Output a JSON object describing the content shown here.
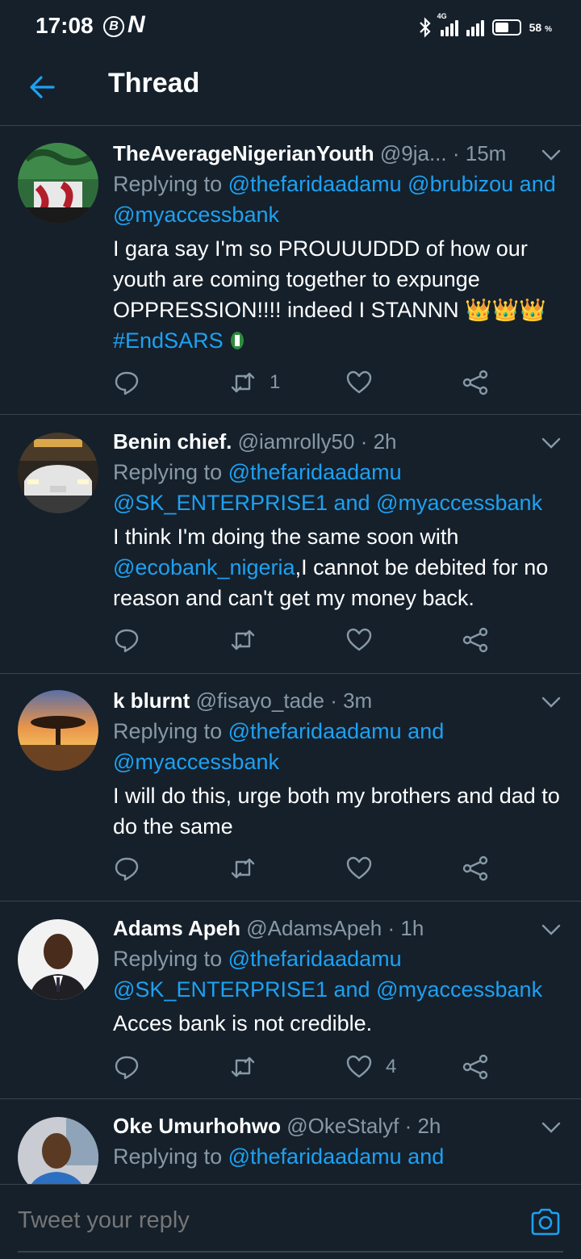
{
  "status_bar": {
    "time": "17:08",
    "network_tag": "4G",
    "battery_percent": "58",
    "battery_unit": "%",
    "battery_level": 0.58
  },
  "header": {
    "title": "Thread"
  },
  "tweets": [
    {
      "name": "TheAverageNigerianYouth",
      "handle": "@9ja...",
      "time": "· 15m",
      "replying_prefix": "Replying to",
      "mentions": [
        "@thefaridaadamu",
        "@brubizou",
        "and",
        "@myaccessbank"
      ],
      "text": "I gara say I'm so PROUUUDDD of how our youth are coming together to expunge OPPRESSION!!!! indeed I STANNN",
      "emoji": "👑👑👑",
      "hashtag": "#EndSARS",
      "retweets": "1",
      "likes": ""
    },
    {
      "name": "Benin chief.",
      "handle": "@iamrolly50",
      "time": "· 2h",
      "replying_prefix": "Replying to",
      "mentions": [
        "@thefaridaadamu",
        "@SK_ENTERPRISE1",
        "and",
        "@myaccessbank"
      ],
      "text_mention": "@ecobank_nigeria",
      "text_before": "I think I'm doing the same soon with",
      "text_after": ",I cannot be debited for no reason and can't get my money back.",
      "retweets": "",
      "likes": ""
    },
    {
      "name": "k blurnt",
      "handle": "@fisayo_tade",
      "time": "· 3m",
      "replying_prefix": "Replying to",
      "mentions": [
        "@thefaridaadamu",
        "and",
        "@myaccessbank"
      ],
      "text": "I will do this, urge both my brothers and dad to do the same",
      "retweets": "",
      "likes": ""
    },
    {
      "name": "Adams Apeh",
      "handle": "@AdamsApeh",
      "time": "· 1h",
      "replying_prefix": "Replying to",
      "mentions": [
        "@thefaridaadamu",
        "@SK_ENTERPRISE1",
        "and",
        "@myaccessbank"
      ],
      "text": "Acces bank is not credible.",
      "retweets": "",
      "likes": "4"
    },
    {
      "name": "Oke Umurhohwo",
      "handle": "@OkeStalyf",
      "time": "· 2h",
      "replying_prefix": "Replying to",
      "mentions": [
        "@thefaridaadamu",
        "and"
      ]
    }
  ],
  "reply_bar": {
    "placeholder": "Tweet your reply"
  },
  "icons": {
    "back": "arrow-left-icon",
    "caret": "chevron-down-icon",
    "reply": "comment-icon",
    "retweet": "retweet-icon",
    "like": "heart-icon",
    "share": "share-icon",
    "camera": "camera-icon"
  },
  "colors": {
    "background": "#15202b",
    "accent": "#1da1f2",
    "secondary_text": "#8899a6",
    "divider": "#38444d"
  }
}
